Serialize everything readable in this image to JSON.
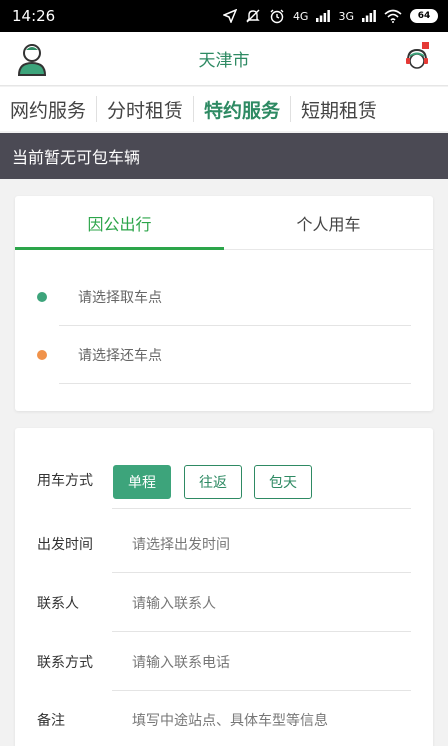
{
  "status_bar": {
    "time": "14:26",
    "network_1": "4G",
    "network_2": "3G",
    "battery": "64",
    "icons": [
      "location-arrow-icon",
      "mute-icon",
      "alarm-icon",
      "signal-icon",
      "signal-icon",
      "wifi-icon",
      "battery-icon"
    ]
  },
  "header": {
    "city": "天津市",
    "left_icon": "user-avatar-icon",
    "right_icon": "customer-service-icon"
  },
  "nav_tabs": [
    {
      "label": "网约服务",
      "active": false
    },
    {
      "label": "分时租赁",
      "active": false
    },
    {
      "label": "特约服务",
      "active": true
    },
    {
      "label": "短期租赁",
      "active": false
    }
  ],
  "banner": {
    "text": "当前暂无可包车辆"
  },
  "trip_card": {
    "tabs": [
      {
        "label": "因公出行",
        "active": true
      },
      {
        "label": "个人用车",
        "active": false
      }
    ],
    "pickup": {
      "placeholder": "请选择取车点",
      "dot_color": "#3da47b"
    },
    "return": {
      "placeholder": "请选择还车点",
      "dot_color": "#f0924a"
    }
  },
  "form": {
    "mode": {
      "label": "用车方式",
      "options": [
        {
          "label": "单程",
          "active": true
        },
        {
          "label": "往返",
          "active": false
        },
        {
          "label": "包天",
          "active": false
        }
      ]
    },
    "depart_time": {
      "label": "出发时间",
      "placeholder": "请选择出发时间"
    },
    "contact": {
      "label": "联系人",
      "placeholder": "请输入联系人"
    },
    "phone": {
      "label": "联系方式",
      "placeholder": "请输入联系电话"
    },
    "note": {
      "label": "备注",
      "placeholder": "填写中途站点、具体车型等信息"
    }
  },
  "colors": {
    "brand_green": "#2e8a63",
    "tab_green": "#2ca54a",
    "banner_bg": "#4b4a54",
    "pickup_dot": "#3da47b",
    "return_dot": "#f0924a"
  }
}
